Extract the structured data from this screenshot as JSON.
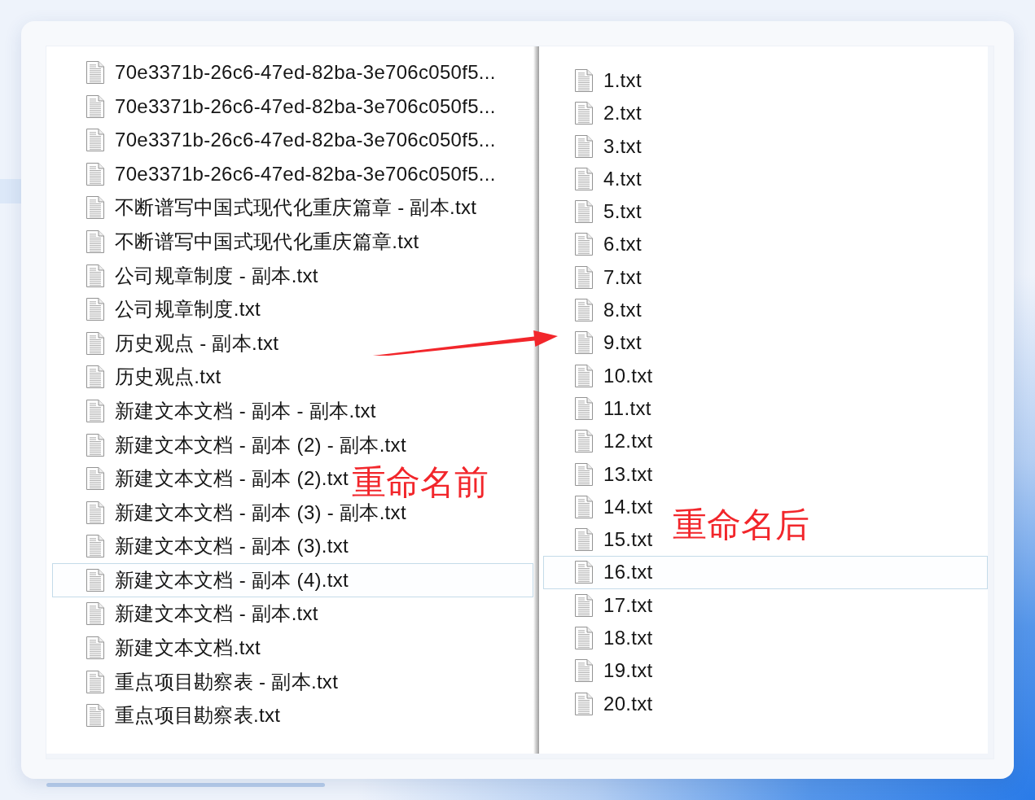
{
  "left_pane": {
    "files": [
      {
        "name": "70e3371b-26c6-47ed-82ba-3e706c050f5...",
        "selected": false
      },
      {
        "name": "70e3371b-26c6-47ed-82ba-3e706c050f5...",
        "selected": false
      },
      {
        "name": "70e3371b-26c6-47ed-82ba-3e706c050f5...",
        "selected": false
      },
      {
        "name": "70e3371b-26c6-47ed-82ba-3e706c050f5...",
        "selected": false
      },
      {
        "name": "不断谱写中国式现代化重庆篇章 - 副本.txt",
        "selected": false
      },
      {
        "name": "不断谱写中国式现代化重庆篇章.txt",
        "selected": false
      },
      {
        "name": "公司规章制度 - 副本.txt",
        "selected": false
      },
      {
        "name": "公司规章制度.txt",
        "selected": false
      },
      {
        "name": "历史观点 - 副本.txt",
        "selected": false
      },
      {
        "name": "历史观点.txt",
        "selected": false
      },
      {
        "name": "新建文本文档 - 副本 - 副本.txt",
        "selected": false
      },
      {
        "name": "新建文本文档 - 副本 (2) - 副本.txt",
        "selected": false
      },
      {
        "name": "新建文本文档 - 副本 (2).txt",
        "selected": false
      },
      {
        "name": "新建文本文档 - 副本 (3) - 副本.txt",
        "selected": false
      },
      {
        "name": "新建文本文档 - 副本 (3).txt",
        "selected": false
      },
      {
        "name": "新建文本文档 - 副本 (4).txt",
        "selected": true
      },
      {
        "name": "新建文本文档 - 副本.txt",
        "selected": false
      },
      {
        "name": "新建文本文档.txt",
        "selected": false
      },
      {
        "name": "重点项目勘察表 - 副本.txt",
        "selected": false
      },
      {
        "name": "重点项目勘察表.txt",
        "selected": false
      }
    ]
  },
  "right_pane": {
    "files": [
      {
        "name": "1.txt",
        "selected": false
      },
      {
        "name": "2.txt",
        "selected": false
      },
      {
        "name": "3.txt",
        "selected": false
      },
      {
        "name": "4.txt",
        "selected": false
      },
      {
        "name": "5.txt",
        "selected": false
      },
      {
        "name": "6.txt",
        "selected": false
      },
      {
        "name": "7.txt",
        "selected": false
      },
      {
        "name": "8.txt",
        "selected": false
      },
      {
        "name": "9.txt",
        "selected": false
      },
      {
        "name": "10.txt",
        "selected": false
      },
      {
        "name": "11.txt",
        "selected": false
      },
      {
        "name": "12.txt",
        "selected": false
      },
      {
        "name": "13.txt",
        "selected": false
      },
      {
        "name": "14.txt",
        "selected": false
      },
      {
        "name": "15.txt",
        "selected": false
      },
      {
        "name": "16.txt",
        "selected": true
      },
      {
        "name": "17.txt",
        "selected": false
      },
      {
        "name": "18.txt",
        "selected": false
      },
      {
        "name": "19.txt",
        "selected": false
      },
      {
        "name": "20.txt",
        "selected": false
      }
    ]
  },
  "annotations": [
    {
      "kind": "label",
      "text": "重命名前"
    },
    {
      "kind": "arrow"
    },
    {
      "kind": "label",
      "text": "重命名后"
    }
  ]
}
